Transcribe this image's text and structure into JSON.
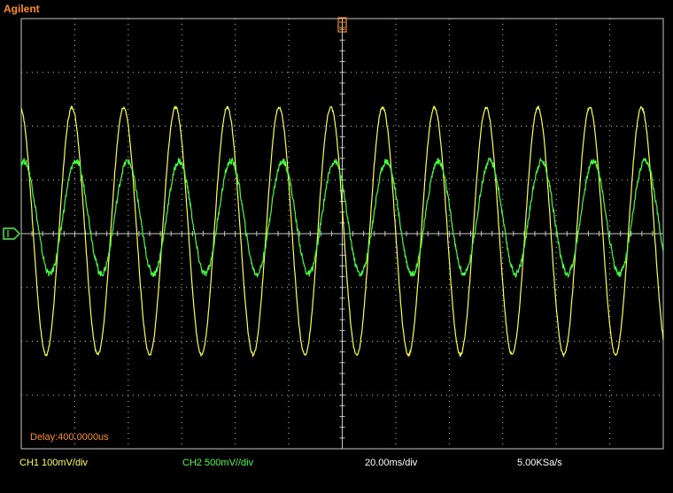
{
  "brand": "Agilent",
  "delay_text": "Delay:400.0000us",
  "status": {
    "ch1_scale": "CH1 100mV/div",
    "ch2_scale": "CH2 500mV//div",
    "timebase": "20.00ms/div",
    "sample_rate": "5.00KSa/s"
  },
  "colors": {
    "background": "#000000",
    "grid": "#c8c8c8",
    "ch1": "#ffff40",
    "ch2": "#40ff40",
    "marker": "#ff8c1a",
    "text": "#ffffff"
  },
  "chart_data": {
    "type": "line",
    "title": "",
    "xlabel": "",
    "ylabel": "",
    "divisions": {
      "x": 12,
      "y": 8
    },
    "xlim": [
      0,
      12
    ],
    "ylim": [
      -4,
      4
    ],
    "series": [
      {
        "name": "CH1",
        "color": "#ffff40",
        "amplitude_div": 2.3,
        "offset_div": 0.05,
        "cycles": 12.4,
        "phase": 1.7
      },
      {
        "name": "CH2",
        "color": "#40ff40",
        "amplitude_div": 1.05,
        "offset_div": 0.3,
        "cycles": 12.4,
        "phase": 1.25
      }
    ]
  }
}
